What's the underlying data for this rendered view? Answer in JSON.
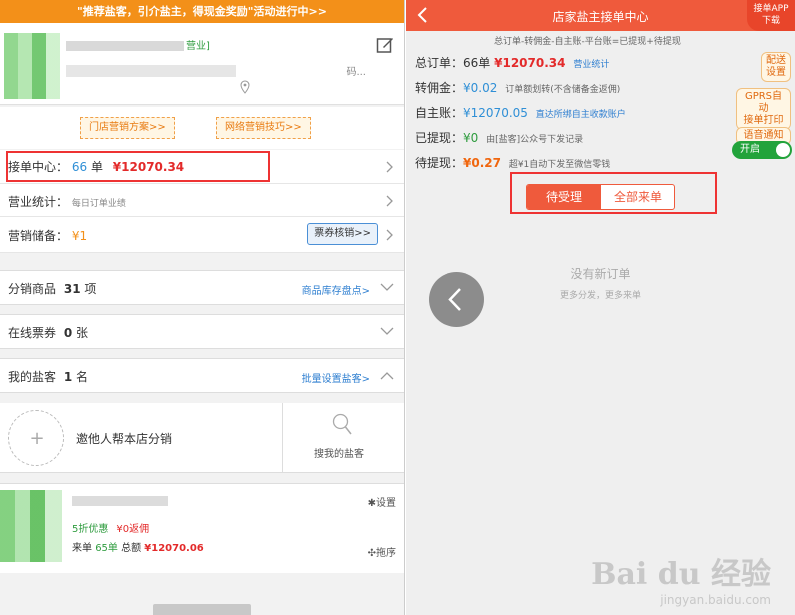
{
  "left": {
    "promo_banner": "\"推荐盐客，引介盐主，得现金奖励\"活动进行中>>",
    "store": {
      "tag": "营业]",
      "address_tail": "码..."
    },
    "tips": {
      "store_marketing": "门店营销方案>>",
      "online_marketing": "网络营销技巧>>"
    },
    "order_center": {
      "label": "接单中心：",
      "count": "66",
      "unit": "单",
      "amount": "¥12070.34"
    },
    "business_stats": {
      "label": "营业统计：",
      "hint": "每日订单业绩"
    },
    "marketing_reserve": {
      "label": "营销储备：",
      "value": "¥1",
      "button": "票券核销>>"
    },
    "sections": [
      {
        "label": "分销商品",
        "value": "31",
        "unit": "项",
        "link": "商品库存盘点>"
      },
      {
        "label": "在线票券",
        "value": "0",
        "unit": "张",
        "link": ""
      },
      {
        "label": "我的盐客",
        "value": "1",
        "unit": "名",
        "link": "批量设置盐客>"
      }
    ],
    "invite": {
      "plus": "+",
      "text": "邀他人帮本店分销",
      "search_label": "搜我的盐客"
    },
    "customer": {
      "settings": "✱设置",
      "discount": "5折优惠",
      "rebate": "¥0返佣",
      "orders_label": "来单",
      "orders_value": "65单",
      "total_label": "总额",
      "total_value": "¥12070.06",
      "sort": "✣拖序"
    }
  },
  "right": {
    "title": "店家盐主接单中心",
    "app_download": [
      "接单APP",
      "下载"
    ],
    "formula": "总订单-转佣金-自主账-平台账=已提现+待提现",
    "stats": {
      "total_orders": {
        "label": "总订单：",
        "count": "66单",
        "amount": "¥12070.34",
        "link": "营业统计"
      },
      "commission": {
        "label": "转佣金：",
        "value": "¥0.02",
        "note": "订单额划转(不含储备金返佣)"
      },
      "self_account": {
        "label": "自主账：",
        "value": "¥12070.05",
        "note": "直达所绑自主收款账户"
      },
      "withdrawn": {
        "label": "已提现：",
        "value": "¥0",
        "note": "由[盐客]公众号下发记录"
      },
      "pending": {
        "label": "待提现：",
        "value": "¥0.27",
        "note": "超¥1自动下发至微信零钱"
      }
    },
    "side_buttons": {
      "delivery": [
        "配送",
        "设置"
      ],
      "gprs_print": [
        "GPRS自动",
        "接单打印"
      ],
      "voice": [
        "语音通知"
      ],
      "toggle": "开启"
    },
    "tabs": {
      "pending": "待受理",
      "all": "全部来单"
    },
    "empty_state": {
      "title": "没有新订单",
      "subtitle": "更多分发，更多来单"
    },
    "watermark": {
      "main": "Bai du 经验",
      "sub": "jingyan.baidu.com"
    }
  }
}
